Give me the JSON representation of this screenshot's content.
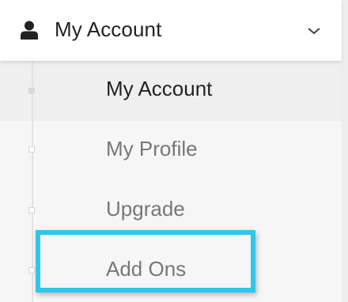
{
  "header": {
    "icon": "user-icon",
    "label": "My Account",
    "toggle_icon": "chevron-down-icon"
  },
  "menu": {
    "items": [
      {
        "label": "My Account",
        "active": true
      },
      {
        "label": "My Profile",
        "active": false
      },
      {
        "label": "Upgrade",
        "active": false
      },
      {
        "label": "Add Ons",
        "active": false,
        "highlighted": true
      }
    ]
  },
  "colors": {
    "highlight": "#33c5e9",
    "active_bg": "#efefef",
    "active_text": "#222222",
    "inactive_text": "#777777"
  }
}
